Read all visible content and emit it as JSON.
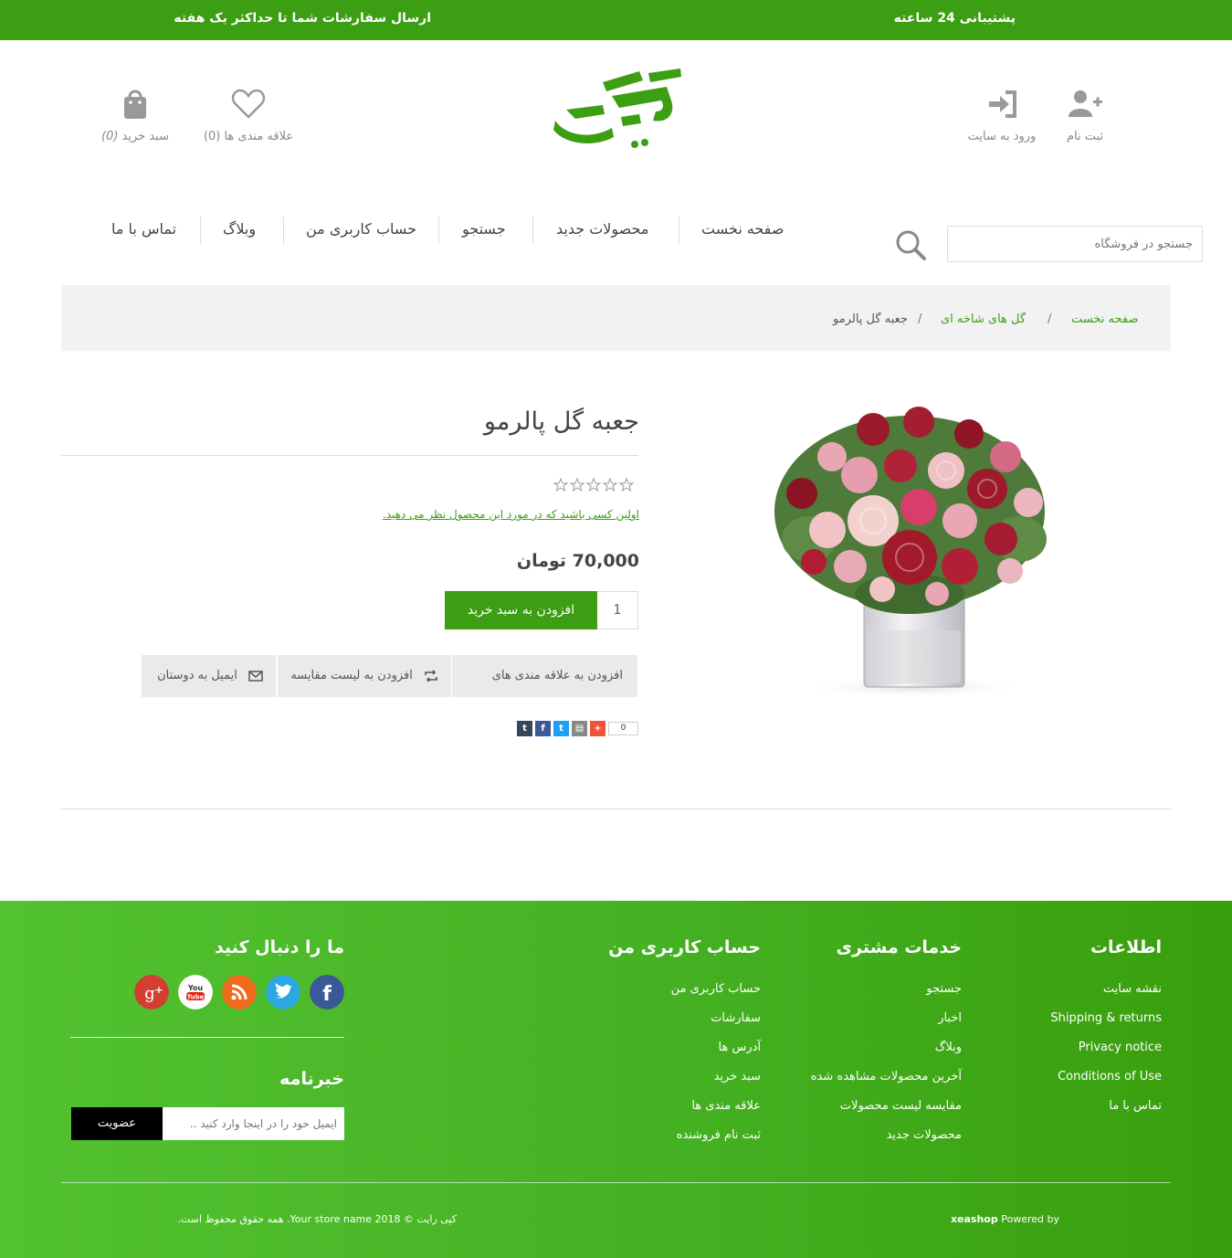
{
  "topbar": {
    "support": "پشتیبانی 24 ساعته",
    "shipping": "ارسال سفارشات شما تا حداکثر یک هفته"
  },
  "header": {
    "register": "ثبت نام",
    "login": "ورود به سایت",
    "wishlist": "علاقه مندی ها (0)",
    "cart_label": "سبد خرید",
    "cart_count": "(0)",
    "brand_color": "#3c9e12"
  },
  "search": {
    "placeholder": "جستجو در فروشگاه"
  },
  "menu": [
    "صفحه نخست",
    "محصولات جدید",
    "جستجو",
    "حساب کاربری من",
    "وبلاگ",
    "تماس با ما"
  ],
  "breadcrumb": {
    "home": "صفحه نخست",
    "category": "گل های شاخه ای",
    "current": "جعبه گل پالرمو",
    "separator": "/"
  },
  "product": {
    "title": "جعبه گل پالرمو",
    "rating": 0,
    "rating_max": 5,
    "review_prompt": "اولین کسی باشید که در مورد این محصول نظر می دهید.",
    "price": "70,000 تومان",
    "quantity": "1",
    "add_to_cart": "افزودن به سبد خرید",
    "add_to_wishlist": "افزودن به علاقه مندی های",
    "add_to_compare": "افزودن به لیست مقایسه",
    "email_friend": "ایمیل به دوستان",
    "share_count": "0"
  },
  "footer": {
    "info": {
      "title": "اطلاعات",
      "links": [
        "نقشه سایت",
        "Shipping & returns",
        "Privacy notice",
        "Conditions of Use",
        "تماس با ما"
      ]
    },
    "service": {
      "title": "خدمات مشتری",
      "links": [
        "جستجو",
        "اخبار",
        "وبلاگ",
        "آخرین محصولات مشاهده شده",
        "مقایسه لیست محصولات",
        "محصولات جدید"
      ]
    },
    "account": {
      "title": "حساب کاربری من",
      "links": [
        "حساب کاربری من",
        "سفارشات",
        "آدرس ها",
        "سبد خرید",
        "علاقه مندی ها",
        "ثبت نام فروشنده"
      ]
    },
    "follow": {
      "title": "ما را دنبال کنید",
      "icons": [
        "facebook-icon",
        "twitter-icon",
        "rss-icon",
        "youtube-icon",
        "google-plus-icon"
      ]
    },
    "newsletter": {
      "title": "خبرنامه",
      "placeholder": "ایمیل خود را در اینجا وارد کنید ..",
      "button": "عضویت"
    },
    "copyright": "کپی رایت © 2018 Your store name. همه حقوق محفوظ است.",
    "powered_prefix": "Powered by",
    "powered_brand": "xeashop"
  }
}
